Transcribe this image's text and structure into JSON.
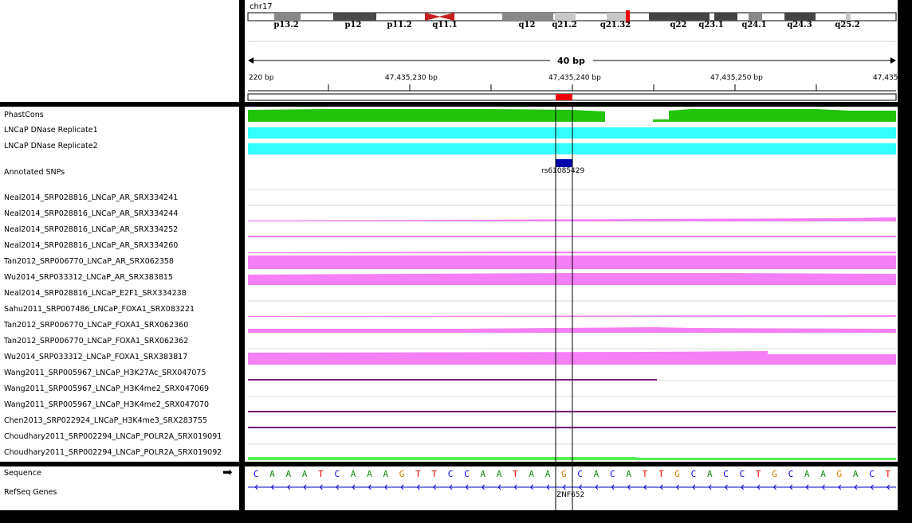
{
  "header": {
    "chromosome": "chr17",
    "bands": [
      "p13.2",
      "p12",
      "p11.2",
      "q11.1",
      "q12",
      "q21.2",
      "q21.32",
      "q22",
      "q23.1",
      "q24.1",
      "q24.3",
      "q25.2"
    ],
    "span_label": "40 bp",
    "ticks": [
      "220 bp",
      "47,435,230 bp",
      "47,435,240 bp",
      "47,435,250 bp",
      "47,435"
    ]
  },
  "tracks": {
    "labels": [
      "PhastCons",
      "LNCaP DNase Replicate1",
      "LNCaP DNase Replicate2",
      "Annotated SNPs",
      "Neal2014_SRP028816_LNCaP_AR_SRX334241",
      "Neal2014_SRP028816_LNCaP_AR_SRX334244",
      "Neal2014_SRP028816_LNCaP_AR_SRX334252",
      "Neal2014_SRP028816_LNCaP_AR_SRX334260",
      "Tan2012_SRP006770_LNCaP_AR_SRX062358",
      "Wu2014_SRP033312_LNCaP_AR_SRX383815",
      "Neal2014_SRP028816_LNCaP_E2F1_SRX334238",
      "Sahu2011_SRP007486_LNCaP_FOXA1_SRX083221",
      "Tan2012_SRP006770_LNCaP_FOXA1_SRX062360",
      "Tan2012_SRP006770_LNCaP_FOXA1_SRX062362",
      "Wu2014_SRP033312_LNCaP_FOXA1_SRX383817",
      "Wang2011_SRP005967_LNCaP_H3K27Ac_SRX047075",
      "Wang2011_SRP005967_LNCaP_H3K4me2_SRX047069",
      "Wang2011_SRP005967_LNCaP_H3K4me2_SRX047070",
      "Chen2013_SRP022924_LNCaP_H3K4me3_SRX283755",
      "Choudhary2011_SRP002294_LNCaP_POLR2A_SRX019091",
      "Choudhary2011_SRP002294_LNCaP_POLR2A_SRX019092"
    ],
    "snp_name": "rs61085429"
  },
  "bottom": {
    "sequence_label": "Sequence",
    "refseq_label": "RefSeq Genes",
    "sequence": "CAAATCAAAGTTCCAATAAGCACATTGCACCTGCAAGACT",
    "gene_name": "ZNF652"
  },
  "colors": {
    "phastcons": "#22c40a",
    "dnase": "#33ffff",
    "chip": "#f57ff5",
    "histone": "#7b1f7b",
    "polr2a": "#55ee55",
    "snp": "#0000aa",
    "base_A": "#1a8a1a",
    "base_C": "#0000ee",
    "base_G": "#d17a00",
    "base_T": "#ee0000"
  }
}
